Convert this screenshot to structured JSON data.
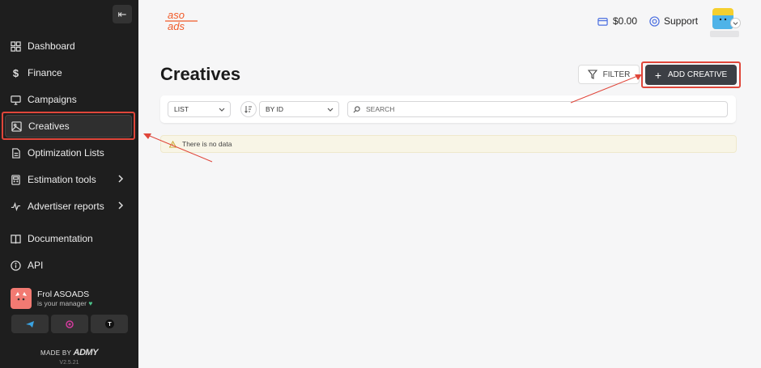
{
  "sidebar": {
    "collapse_label": "⇤",
    "items": [
      {
        "label": "Dashboard",
        "icon": "dashboard-icon"
      },
      {
        "label": "Finance",
        "icon": "dollar-icon"
      },
      {
        "label": "Campaigns",
        "icon": "monitor-icon"
      },
      {
        "label": "Creatives",
        "icon": "image-icon",
        "active": true
      },
      {
        "label": "Optimization Lists",
        "icon": "document-icon"
      },
      {
        "label": "Estimation tools",
        "icon": "calculator-icon",
        "has_submenu": true
      },
      {
        "label": "Advertiser reports",
        "icon": "activity-icon",
        "has_submenu": true
      },
      {
        "label": "Documentation",
        "icon": "book-icon"
      },
      {
        "label": "API",
        "icon": "info-icon"
      }
    ],
    "manager": {
      "name": "Frol ASOADS",
      "subtitle": "is your manager"
    },
    "contacts": [
      "telegram-icon",
      "email-icon",
      "t-icon"
    ],
    "made_by": "MADE BY",
    "made_by_brand": "ADMY",
    "version": "V2.5.21"
  },
  "header": {
    "logo_top": "aso",
    "logo_bottom": "ads",
    "balance": "$0.00",
    "support": "Support"
  },
  "main": {
    "title": "Creatives",
    "filter_label": "FILTER",
    "add_label": "ADD CREATIVE",
    "view_select": "LIST",
    "sort_select": "BY ID",
    "search_placeholder": "SEARCH",
    "empty_message": "There is no data"
  },
  "colors": {
    "sidebar_bg": "#1e1e1e",
    "accent_orange": "#f05a28",
    "annotation_red": "#e0463a",
    "primary_button": "#3c3f45"
  }
}
